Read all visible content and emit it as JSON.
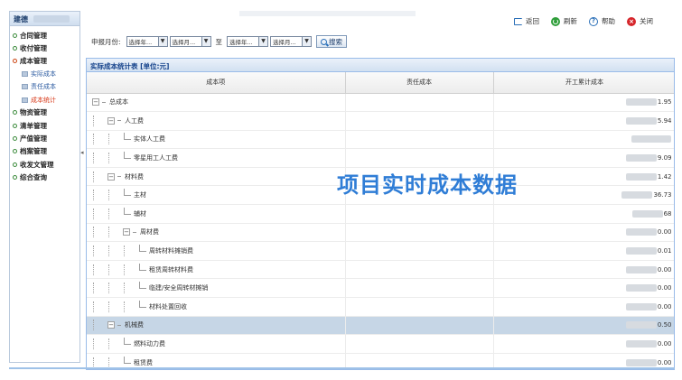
{
  "sidebar": {
    "title": "建德",
    "items": [
      {
        "label": "合同管理",
        "open": false
      },
      {
        "label": "收付管理",
        "open": false
      },
      {
        "label": "成本管理",
        "open": true,
        "children": [
          {
            "label": "实际成本",
            "active": false
          },
          {
            "label": "责任成本",
            "active": false
          },
          {
            "label": "成本统计",
            "active": true
          }
        ]
      },
      {
        "label": "物资管理",
        "open": false
      },
      {
        "label": "清单管理",
        "open": false
      },
      {
        "label": "产值管理",
        "open": false
      },
      {
        "label": "档案管理",
        "open": false
      },
      {
        "label": "收发文管理",
        "open": false
      },
      {
        "label": "综合查询",
        "open": false
      }
    ]
  },
  "toolbar": {
    "back": "返回",
    "refresh": "刷新",
    "help": "帮助",
    "close": "关闭"
  },
  "filter": {
    "label": "申报月份:",
    "year_placeholder": "选择年...",
    "month_placeholder": "选择月...",
    "to": "至",
    "search": "搜索"
  },
  "panel": {
    "title": "实际成本统计表 [单位:元]",
    "columns": [
      "成本项",
      "责任成本",
      "开工累计成本"
    ],
    "rows": [
      {
        "name": "总成本",
        "depth": 0,
        "toggle": "-",
        "value": "1.95"
      },
      {
        "name": "人工费",
        "depth": 1,
        "toggle": "-",
        "value": "5.94"
      },
      {
        "name": "实体人工费",
        "depth": 2,
        "toggle": "",
        "value": ""
      },
      {
        "name": "零星用工人工费",
        "depth": 2,
        "toggle": "",
        "value": "9.09"
      },
      {
        "name": "材料费",
        "depth": 1,
        "toggle": "-",
        "value": "1.42"
      },
      {
        "name": "主材",
        "depth": 2,
        "toggle": "",
        "value": "36.73"
      },
      {
        "name": "辅材",
        "depth": 2,
        "toggle": "",
        "value": "68"
      },
      {
        "name": "周材费",
        "depth": 2,
        "toggle": "-",
        "value": "0.00"
      },
      {
        "name": "周转材料摊销费",
        "depth": 3,
        "toggle": "",
        "value": "0.01"
      },
      {
        "name": "租赁周转材料费",
        "depth": 3,
        "toggle": "",
        "value": "0.00"
      },
      {
        "name": "临建/安全周转材摊销",
        "depth": 3,
        "toggle": "",
        "value": "0.00"
      },
      {
        "name": "材料处置回收",
        "depth": 3,
        "toggle": "",
        "value": "0.00"
      },
      {
        "name": "机械费",
        "depth": 1,
        "toggle": "-",
        "value": "0.50",
        "selected": true
      },
      {
        "name": "燃料动力费",
        "depth": 2,
        "toggle": "",
        "value": "0.00"
      },
      {
        "name": "租赁费",
        "depth": 2,
        "toggle": "",
        "value": "0.00"
      }
    ]
  },
  "watermark": "项目实时成本数据",
  "colors": {
    "accent": "#2f7dd6",
    "header_blue": "#15428b",
    "selected_row": "#c6d6e6"
  }
}
